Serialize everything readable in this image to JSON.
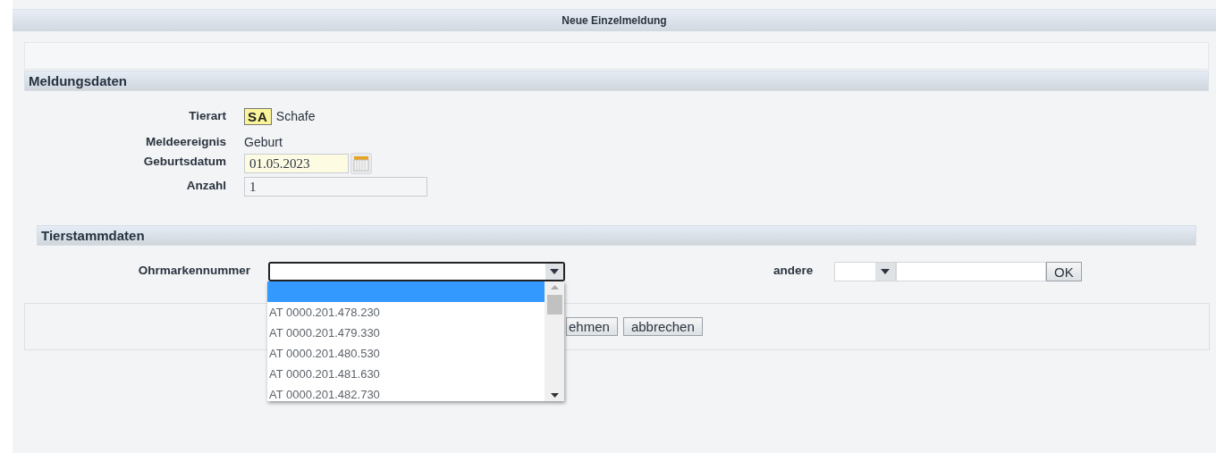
{
  "window": {
    "title": "Neue Einzelmeldung"
  },
  "report": {
    "title": "Meldungsdaten",
    "fields": [
      {
        "kind": "species",
        "label": "Tierart",
        "code": "SA",
        "value": "Schafe"
      },
      {
        "kind": "text",
        "label": "Meldeereignis",
        "value": "Geburt"
      },
      {
        "kind": "date",
        "label": "Geburtsdatum",
        "value": "01.05.2023"
      },
      {
        "kind": "input",
        "label": "Anzahl",
        "value": "1"
      }
    ]
  },
  "master": {
    "title": "Tierstammdaten",
    "ear_tag": {
      "label": "Ohrmarkennummer",
      "expanded": true,
      "options": [
        {
          "selected": true
        },
        {
          "label": "AT 0000.201.478.230",
          "selected": false
        },
        {
          "label": "AT 0000.201.479.330",
          "selected": false
        },
        {
          "label": "AT 0000.201.480.530",
          "selected": false
        },
        {
          "label": "AT 0000.201.481.630",
          "selected": false
        },
        {
          "label": "AT 0000.201.482.730",
          "selected": false
        }
      ]
    },
    "other": {
      "label": "andere",
      "button": "OK"
    }
  },
  "buttons": [
    {
      "label": "ehmen"
    },
    {
      "label": "abbrechen"
    }
  ]
}
